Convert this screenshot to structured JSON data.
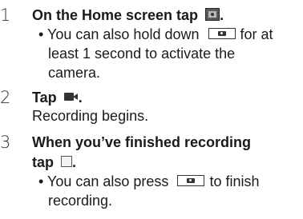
{
  "steps": [
    {
      "number": "1",
      "title_prefix": "On the Home screen tap",
      "title_suffix": ".",
      "bullet_symbol": "•",
      "bullet_line1_prefix": "You can also hold down",
      "bullet_line1_suffix": "for at",
      "bullet_line2": "least 1 second to activate the",
      "bullet_line3": "camera."
    },
    {
      "number": "2",
      "title_prefix": "Tap",
      "title_suffix": ".",
      "body": "Recording begins."
    },
    {
      "number": "3",
      "title_line1": "When you’ve finished recording",
      "title_line2_prefix": "tap",
      "title_line2_suffix": ".",
      "bullet_symbol": "•",
      "bullet_line1_prefix": "You can also press",
      "bullet_line1_suffix": "to finish",
      "bullet_line2": "recording."
    }
  ],
  "icons": {
    "camera_app": "camera-app-icon",
    "camera_key": "camera-key-icon",
    "video_record": "video-record-icon",
    "stop": "stop-icon"
  }
}
